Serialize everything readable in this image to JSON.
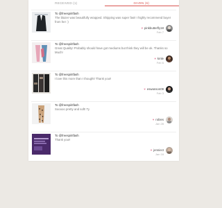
{
  "tabs": {
    "received": "RECEIVED (1)",
    "given": "GIVEN (6)"
  },
  "colors": {
    "accent": "#d9534f",
    "heart": "#e58aa3",
    "background": "#ece9e4"
  },
  "feedback": [
    {
      "to": "To @freespiritfash",
      "message": "The blazer was beautifully wrapped. Shipping was super fast! I highly recommend buyer from her :)",
      "user": "pinkbutterfly18",
      "date": "Feb 7",
      "thumb_icon": "blazer-photo",
      "avatar_icon": "user-avatar"
    },
    {
      "to": "To @freespiritfash",
      "message": "Great Quality! Probably should have got mediums but think they will be ok. Thanks so Much!",
      "user": "kmle",
      "date": "Feb 6",
      "thumb_icon": "pink-pants-photo",
      "avatar_icon": "user-avatar"
    },
    {
      "to": "To @freespiritfash",
      "message": "I love this more than I thought! Thank you!!",
      "user": "eswanson09",
      "date": "Feb 3",
      "thumb_icon": "patterned-pants-photo",
      "avatar_icon": "user-avatar"
    },
    {
      "to": "To @freespiritfash",
      "message": "Sooooo pretty and soft! Ty",
      "user": "robies",
      "date": "Jan 28",
      "thumb_icon": "leopard-leggings-photo",
      "avatar_icon": "user-avatar"
    },
    {
      "to": "To @freespiritfash",
      "message": "Thank you!!",
      "user": "jenniect",
      "date": "Jan 18",
      "thumb_icon": "purple-listing-photo",
      "avatar_icon": "user-avatar"
    }
  ]
}
